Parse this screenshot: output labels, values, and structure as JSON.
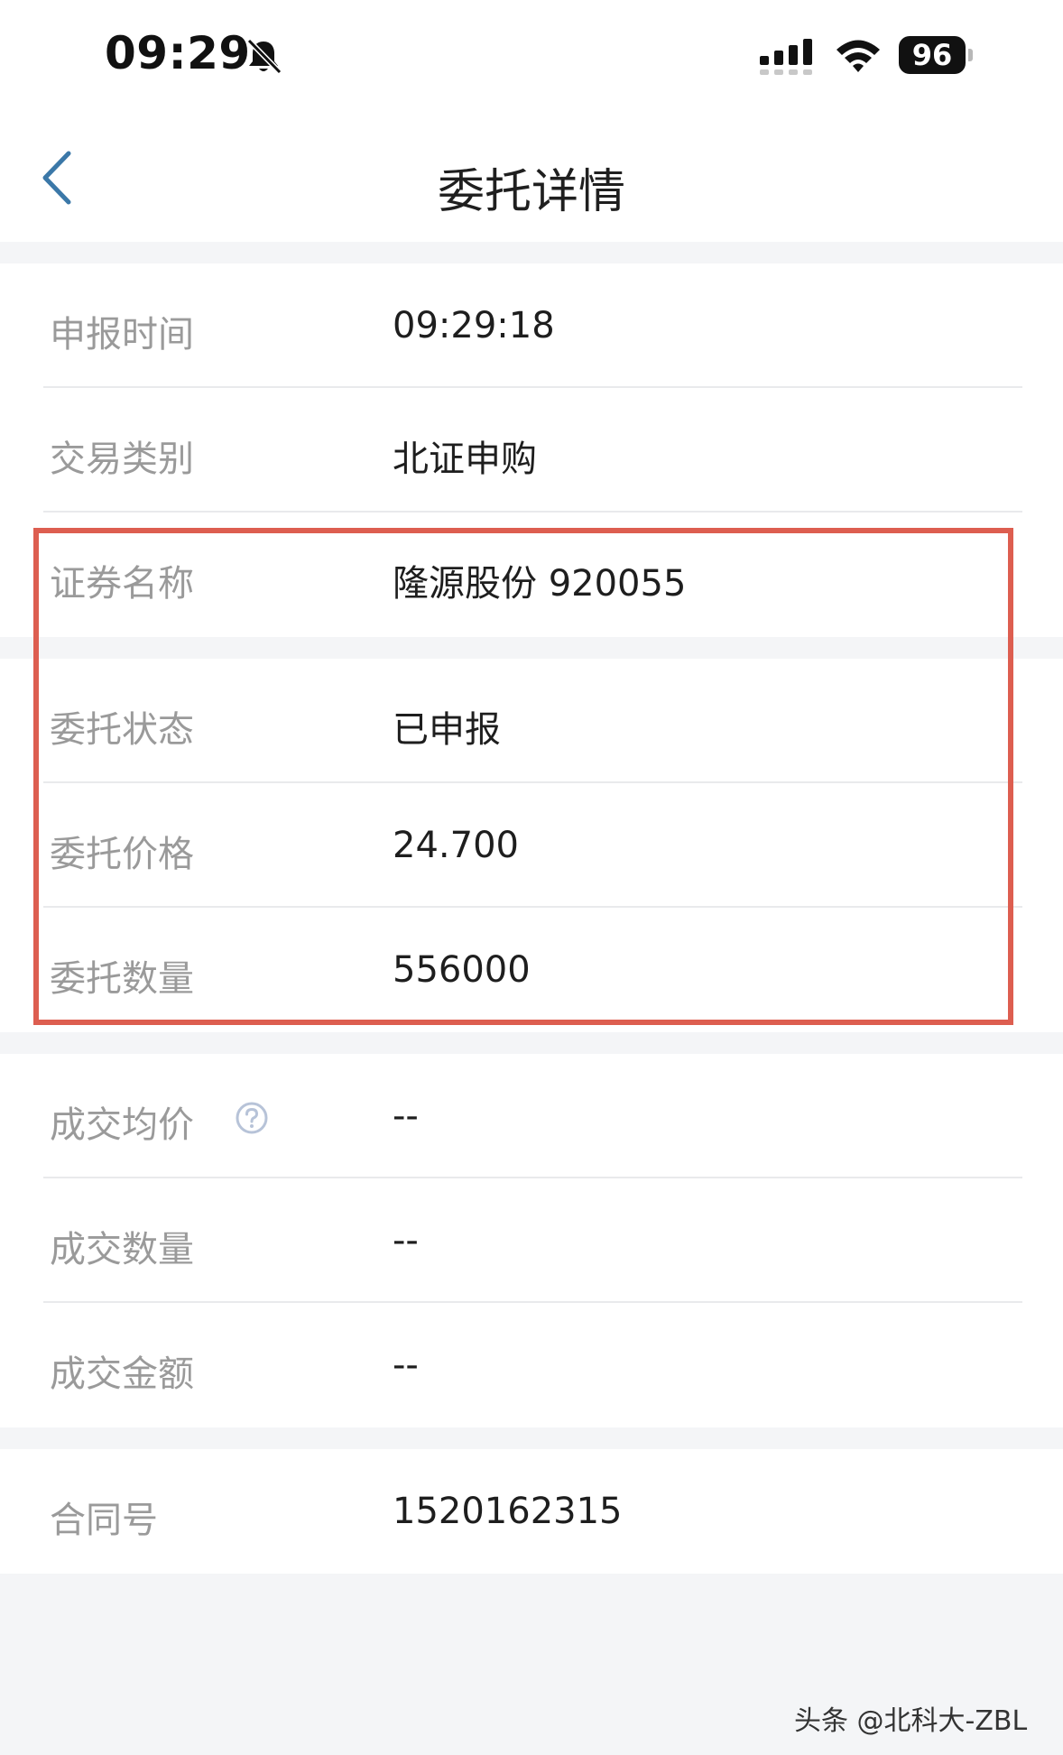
{
  "status_bar": {
    "time": "09:29",
    "battery": "96",
    "icons": [
      "bell-slash-icon",
      "cellular-signal-icon",
      "wifi-icon",
      "battery-icon"
    ]
  },
  "nav": {
    "title": "委托详情",
    "back_icon": "chevron-left-icon"
  },
  "section1": {
    "rows": [
      {
        "label": "申报时间",
        "value": "09:29:18"
      },
      {
        "label": "交易类别",
        "value": "北证申购"
      },
      {
        "label": "证券名称",
        "value": "隆源股份 920055"
      }
    ]
  },
  "section2": {
    "rows": [
      {
        "label": "委托状态",
        "value": "已申报"
      },
      {
        "label": "委托价格",
        "value": "24.700"
      },
      {
        "label": "委托数量",
        "value": "556000"
      }
    ]
  },
  "section3": {
    "rows": [
      {
        "label": "成交均价",
        "value": "--",
        "icon": "question-circle-icon"
      },
      {
        "label": "成交数量",
        "value": "--"
      },
      {
        "label": "成交金额",
        "value": "--"
      }
    ]
  },
  "section4": {
    "rows": [
      {
        "label": "合同号",
        "value": "1520162315"
      }
    ]
  },
  "highlight_color": "#dd5e50",
  "watermark": "头条 @北科大-ZBL"
}
